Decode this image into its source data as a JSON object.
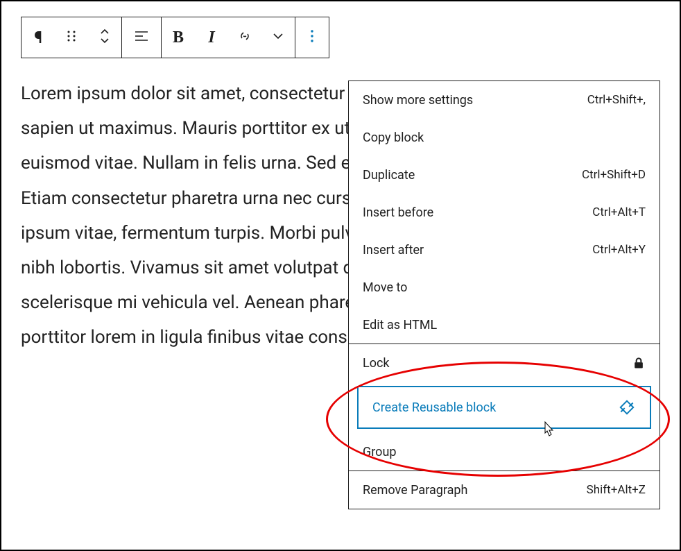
{
  "paragraph": "Lorem ipsum dolor sit amet, consectetur adipiscing elit. Vestibulum maximus et sapien ut maximus. Mauris porttitor ex ut dui congue, in accumsan ante euismod vitae. Nullam in felis urna. Sed et placerat quam eu, eleifend lacus. Etiam consectetur pharetra urna nec cursus. Aliquam non risus efficitur, feugiat ipsum vitae, fermentum turpis. Morbi pulvinar sed mauris id laoreet. Fusce et nibh lobortis. Vivamus sit amet volutpat dolor. Qui fermentum tortor neque, nec scelerisque mi vehicula vel. Aenean pharetra urna eros, in sollicitudin. Donec porttitor lorem in ligula finibus vitae consequat tortor.",
  "menu": {
    "s1": [
      {
        "label": "Show more settings",
        "shortcut": "Ctrl+Shift+,"
      },
      {
        "label": "Copy block",
        "shortcut": ""
      },
      {
        "label": "Duplicate",
        "shortcut": "Ctrl+Shift+D"
      },
      {
        "label": "Insert before",
        "shortcut": "Ctrl+Alt+T"
      },
      {
        "label": "Insert after",
        "shortcut": "Ctrl+Alt+Y"
      },
      {
        "label": "Move to",
        "shortcut": ""
      },
      {
        "label": "Edit as HTML",
        "shortcut": ""
      }
    ],
    "s2": [
      {
        "label": "Lock",
        "icon": "lock"
      },
      {
        "label": "Create Reusable block",
        "icon": "reusable",
        "hl": true
      },
      {
        "label": "Group"
      }
    ],
    "s3": [
      {
        "label": "Remove Paragraph",
        "shortcut": "Shift+Alt+Z"
      }
    ]
  },
  "annotation_color": "#e60000",
  "highlight_color": "#0a7cba"
}
